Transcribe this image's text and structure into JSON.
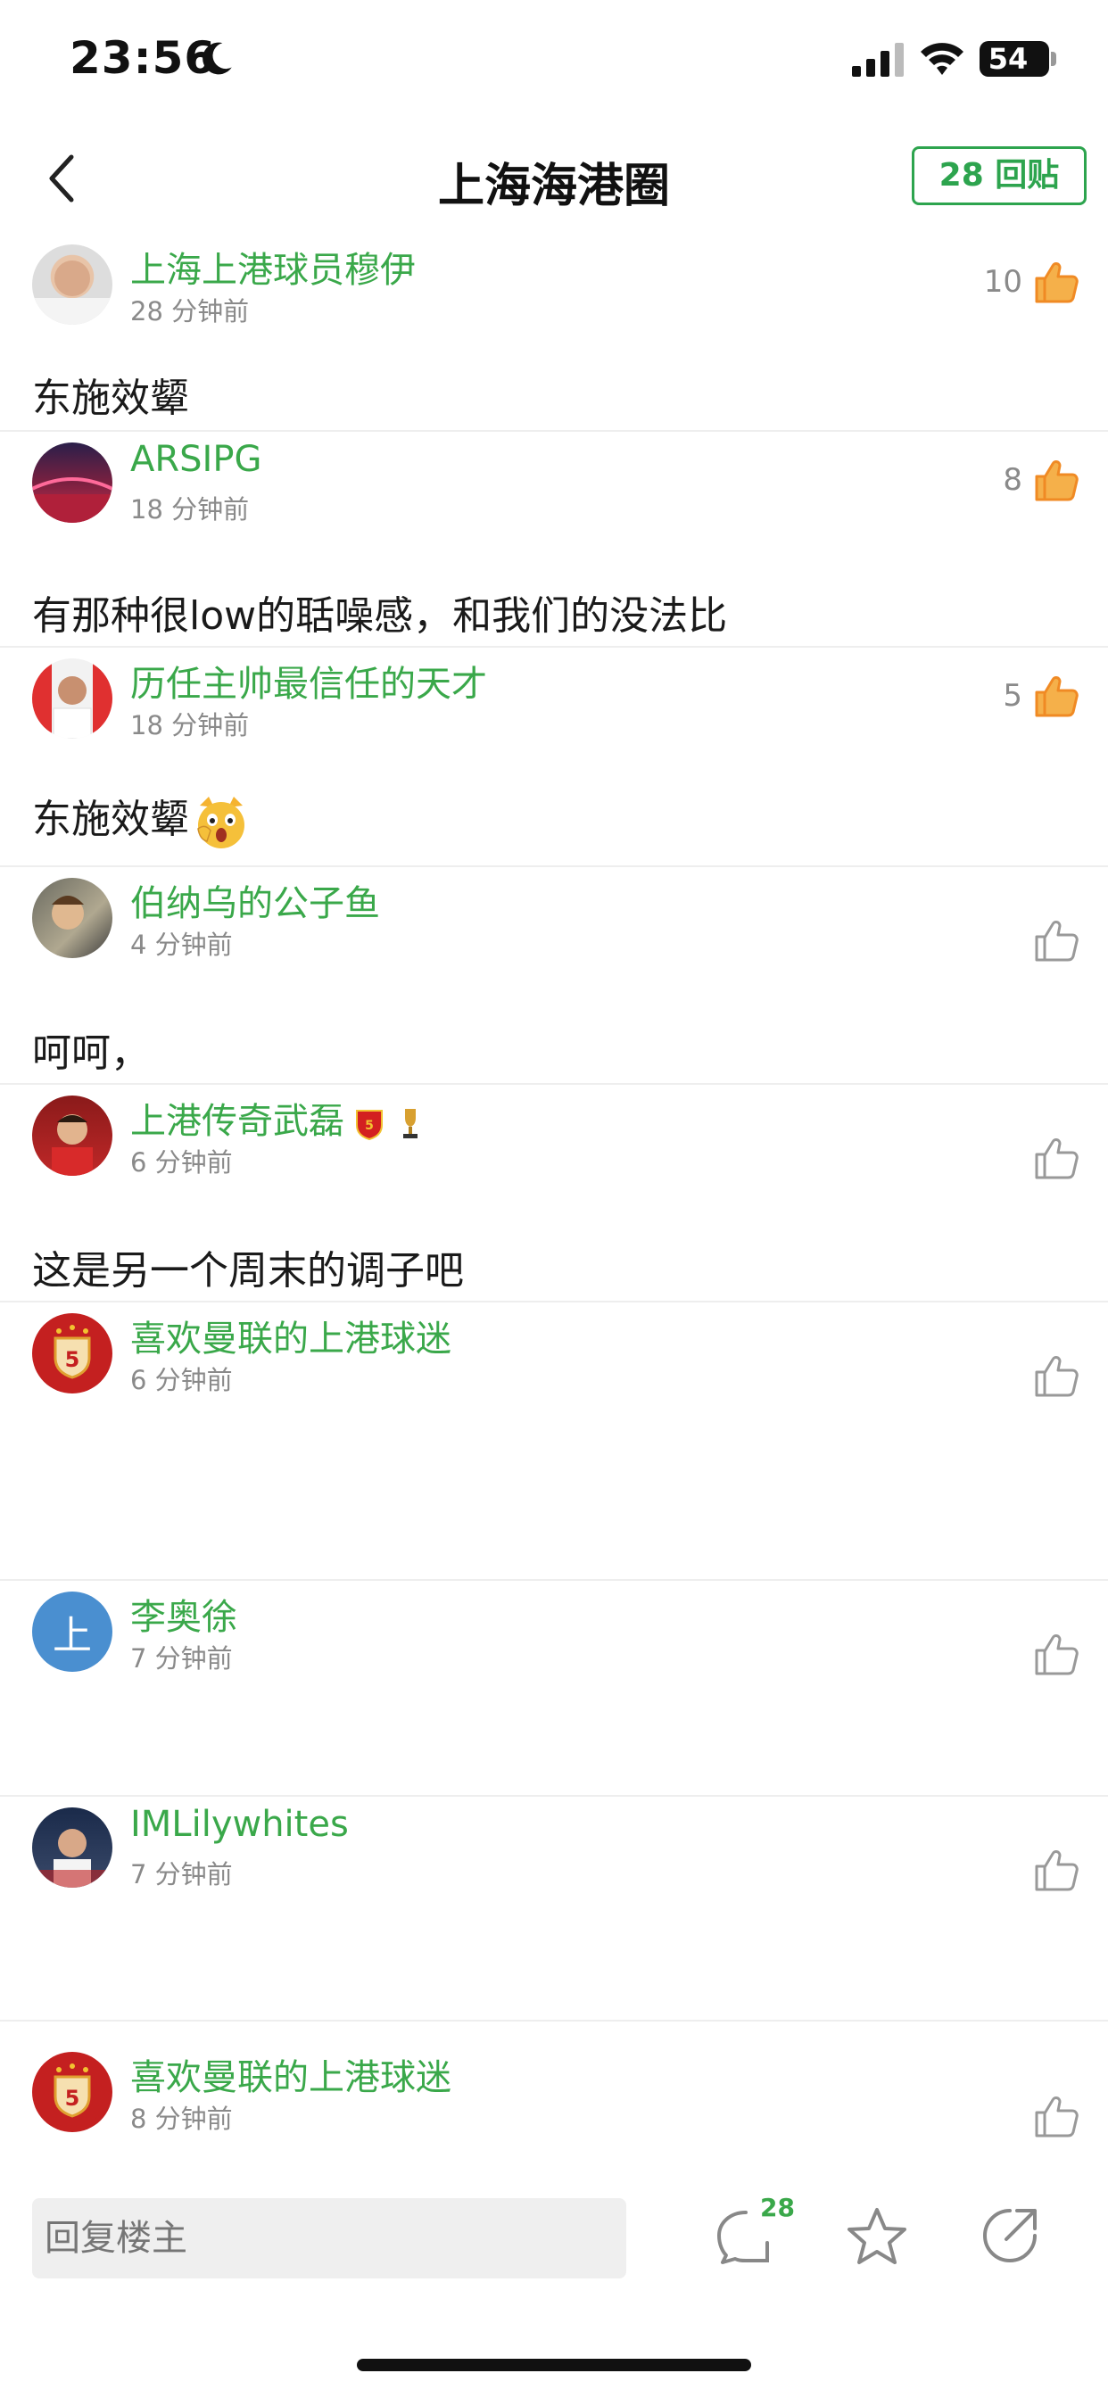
{
  "status_bar": {
    "time": "23:56",
    "battery": "54"
  },
  "header": {
    "title": "上海海港圈",
    "reply_button": "28 回贴"
  },
  "posts": [
    {
      "username": "上海上港球员穆伊",
      "time": "28 分钟前",
      "likes": "10",
      "content": "东施效颦",
      "liked": true
    },
    {
      "username": "ARSIPG",
      "time": "18 分钟前",
      "likes": "8",
      "content": "有那种很low的聒噪感，和我们的没法比",
      "liked": true
    },
    {
      "username": "历任主帅最信任的天才",
      "time": "18 分钟前",
      "likes": "5",
      "content": "东施效颦",
      "liked": true
    },
    {
      "username": "伯纳乌的公子鱼",
      "time": "4 分钟前",
      "likes": "",
      "content": "呵呵，",
      "liked": false
    },
    {
      "username": "上港传奇武磊",
      "time": "6 分钟前",
      "likes": "",
      "content": "这是另一个周末的调子吧",
      "liked": false
    },
    {
      "username": "喜欢曼联的上港球迷",
      "time": "6 分钟前",
      "likes": "",
      "content": "",
      "liked": false
    },
    {
      "username": "李奥徐",
      "time": "7 分钟前",
      "likes": "",
      "content": "",
      "liked": false,
      "avatar_letter": "上"
    },
    {
      "username": "IMLilywhites",
      "time": "7 分钟前",
      "likes": "",
      "content": "",
      "liked": false
    },
    {
      "username": "喜欢曼联的上港球迷",
      "time": "8 分钟前",
      "likes": "",
      "content": "",
      "liked": false
    }
  ],
  "bottom_bar": {
    "reply_placeholder": "回复楼主",
    "comment_count": "28"
  },
  "colors": {
    "accent_green": "#3aa84a",
    "like_orange": "#f08a24",
    "muted_gray": "#8a8a8a"
  },
  "icons": [
    "back-icon",
    "thumbs-up-icon",
    "comment-icon",
    "star-icon",
    "share-icon",
    "moon-icon",
    "signal-icon",
    "wifi-icon"
  ]
}
